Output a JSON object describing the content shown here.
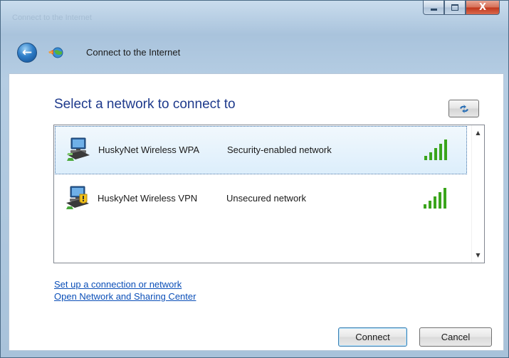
{
  "window": {
    "faded_breadcrumb": "Connect to the Internet",
    "caption": {
      "minimize": "",
      "maximize": "",
      "close": "X"
    }
  },
  "nav": {
    "back_icon": "back-arrow-icon",
    "app_icon": "network-globe-icon",
    "title": "Connect to the Internet"
  },
  "main": {
    "heading": "Select a network to connect to",
    "refresh_icon": "refresh-icon",
    "networks": [
      {
        "name": "HuskyNet Wireless WPA",
        "security": "Security-enabled network",
        "signal_bars": 5,
        "selected": true,
        "icon": "secured-network-icon"
      },
      {
        "name": "HuskyNet Wireless VPN",
        "security": "Unsecured network",
        "signal_bars": 5,
        "selected": false,
        "icon": "unsecured-network-warning-icon"
      }
    ],
    "links": {
      "setup": "Set up a connection or network",
      "sharing_center": "Open Network and Sharing Center"
    }
  },
  "buttons": {
    "connect_label": "Connect",
    "cancel_label": "Cancel"
  },
  "colors": {
    "heading": "#1e3a8c",
    "link": "#0b4fb8",
    "signal": "#3aa51b",
    "selection": "#dceefb"
  }
}
